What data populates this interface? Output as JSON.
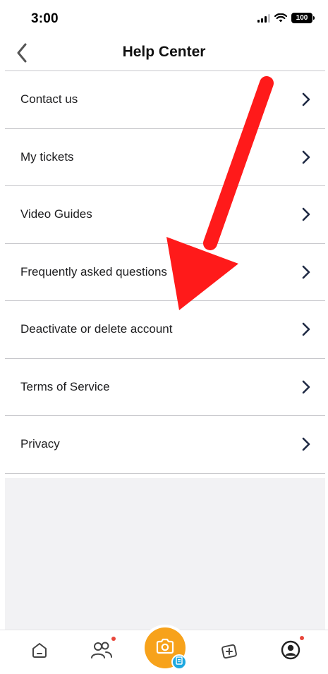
{
  "status_bar": {
    "time": "3:00",
    "battery": "100"
  },
  "header": {
    "title": "Help Center",
    "back_icon": "chevron-left-icon"
  },
  "menu": {
    "items": [
      {
        "label": "Contact us"
      },
      {
        "label": "My tickets"
      },
      {
        "label": "Video Guides"
      },
      {
        "label": "Frequently asked questions"
      },
      {
        "label": "Deactivate or delete account"
      },
      {
        "label": "Terms of Service"
      },
      {
        "label": "Privacy"
      }
    ]
  },
  "tab_bar": {
    "tabs": [
      {
        "icon": "home-icon"
      },
      {
        "icon": "friends-icon"
      },
      {
        "icon": "camera-icon"
      },
      {
        "icon": "add-card-icon"
      },
      {
        "icon": "profile-icon"
      }
    ]
  },
  "colors": {
    "accent": "#f7a21b",
    "badge": "#1ea8e0",
    "notification": "#e8463b",
    "annotation_arrow": "#ff1a1a",
    "divider": "#c8c8cc"
  }
}
